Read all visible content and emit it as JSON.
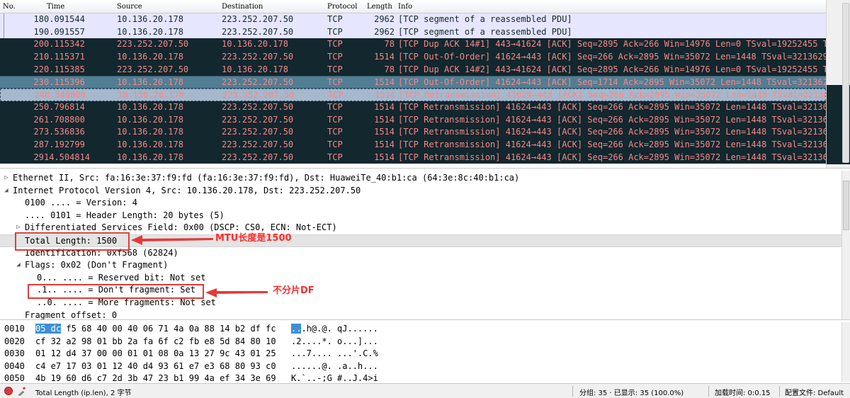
{
  "packet_list": {
    "columns": [
      "No.",
      "Time",
      "Source",
      "Destination",
      "Protocol",
      "Length",
      "Info"
    ],
    "rows": [
      {
        "no": "18",
        "time": "0.091544",
        "src": "10.136.20.178",
        "dst": "223.252.207.50",
        "proto": "TCP",
        "len": "2962",
        "info": "[TCP segment of a reassembled PDU]",
        "style": "light"
      },
      {
        "no": "19",
        "time": "0.091557",
        "src": "10.136.20.178",
        "dst": "223.252.207.50",
        "proto": "TCP",
        "len": "2962",
        "info": "[TCP segment of a reassembled PDU]",
        "style": "light"
      },
      {
        "no": "20",
        "time": "0.115342",
        "src": "223.252.207.50",
        "dst": "10.136.20.178",
        "proto": "TCP",
        "len": "78",
        "info": "[TCP Dup ACK 14#1] 443→41624 [ACK] Seq=2895 Ack=266 Win=14976 Len=0 TSval=19252455 TS",
        "style": "dark"
      },
      {
        "no": "21",
        "time": "0.115371",
        "src": "10.136.20.178",
        "dst": "223.252.207.50",
        "proto": "TCP",
        "len": "1514",
        "info": "[TCP Out-Of-Order] 41624→443 [ACK] Seq=266 Ack=2895 Win=35072 Len=1448 TSval=3213629",
        "style": "dark"
      },
      {
        "no": "22",
        "time": "0.115385",
        "src": "223.252.207.50",
        "dst": "10.136.20.178",
        "proto": "TCP",
        "len": "78",
        "info": "[TCP Dup ACK 14#2] 443→41624 [ACK] Seq=2895 Ack=266 Win=14976 Len=0 TSval=19252455 TS",
        "style": "dark"
      },
      {
        "no": "23",
        "time": "0.115396",
        "src": "10.136.20.178",
        "dst": "223.252.207.50",
        "proto": "TCP",
        "len": "1514",
        "info": "[TCP Out-Of-Order] 41624→443 [ACK] Seq=1714 Ack=2895 Win=35072 Len=1448 TSval=321362",
        "style": "dark-sel"
      },
      {
        "no": "24",
        "time": "0.340800",
        "src": "10.136.20.178",
        "dst": "223.252.207.50",
        "proto": "TCP",
        "len": "1514",
        "info": "[TCP Retransmission] 41624→443 [ACK] Seq=266 Ack=2895 Win=35072 Len=1448 TSval=32136",
        "style": "focus"
      },
      {
        "no": "25",
        "time": "0.796814",
        "src": "10.136.20.178",
        "dst": "223.252.207.50",
        "proto": "TCP",
        "len": "1514",
        "info": "[TCP Retransmission] 41624→443 [ACK] Seq=266 Ack=2895 Win=35072 Len=1448 TSval=32136",
        "style": "dark"
      },
      {
        "no": "26",
        "time": "1.708800",
        "src": "10.136.20.178",
        "dst": "223.252.207.50",
        "proto": "TCP",
        "len": "1514",
        "info": "[TCP Retransmission] 41624→443 [ACK] Seq=266 Ack=2895 Win=35072 Len=1448 TSval=32136",
        "style": "dark"
      },
      {
        "no": "27",
        "time": "3.536836",
        "src": "10.136.20.178",
        "dst": "223.252.207.50",
        "proto": "TCP",
        "len": "1514",
        "info": "[TCP Retransmission] 41624→443 [ACK] Seq=266 Ack=2895 Win=35072 Len=1448 TSval=32136",
        "style": "dark"
      },
      {
        "no": "28",
        "time": "7.192799",
        "src": "10.136.20.178",
        "dst": "223.252.207.50",
        "proto": "TCP",
        "len": "1514",
        "info": "[TCP Retransmission] 41624→443 [ACK] Seq=266 Ack=2895 Win=35072 Len=1448 TSval=32136",
        "style": "dark"
      },
      {
        "no": "29",
        "time": "14.504814",
        "src": "10.136.20.178",
        "dst": "223.252.207.50",
        "proto": "TCP",
        "len": "1514",
        "info": "[TCP Retransmission] 41624→443 [ACK] Seq=266 Ack=2895 Win=35072 Len=1448 TSval=32136",
        "style": "dark"
      }
    ]
  },
  "details": {
    "rows": [
      {
        "indent": 0,
        "toggle": "collapsed",
        "text": "Ethernet II, Src: fa:16:3e:37:f9:fd (fa:16:3e:37:f9:fd), Dst: HuaweiTe_40:b1:ca (64:3e:8c:40:b1:ca)"
      },
      {
        "indent": 0,
        "toggle": "expanded",
        "text": "Internet Protocol Version 4, Src: 10.136.20.178, Dst: 223.252.207.50"
      },
      {
        "indent": 1,
        "toggle": "none",
        "text": "0100 .... = Version: 4"
      },
      {
        "indent": 1,
        "toggle": "none",
        "text": ".... 0101 = Header Length: 20 bytes (5)"
      },
      {
        "indent": 1,
        "toggle": "collapsed",
        "text": "Differentiated Services Field: 0x00 (DSCP: CS0, ECN: Not-ECT)"
      },
      {
        "indent": 1,
        "toggle": "none",
        "text": "Total Length: 1500",
        "selected": true
      },
      {
        "indent": 1,
        "toggle": "none",
        "text": "Identification: 0xf568 (62824)"
      },
      {
        "indent": 1,
        "toggle": "expanded",
        "text": "Flags: 0x02 (Don't Fragment)"
      },
      {
        "indent": 2,
        "toggle": "none",
        "text": "0... .... = Reserved bit: Not set"
      },
      {
        "indent": 2,
        "toggle": "none",
        "text": ".1.. .... = Don't fragment: Set"
      },
      {
        "indent": 2,
        "toggle": "none",
        "text": "..0. .... = More fragments: Not set"
      },
      {
        "indent": 1,
        "toggle": "none",
        "text": "Fragment offset: 0"
      }
    ],
    "annotations": {
      "mtu": "MTU长度是1500",
      "df": "不分片DF"
    },
    "annotation_color": "#ff2b2b"
  },
  "bytes": {
    "rows": [
      {
        "offset": "0010",
        "hex_hl": "05 dc",
        "hex": "f5 68 40 00 40 06  71 4a 0a 88 14 b2 df fc",
        "ascii_hl": "..",
        "ascii": ".h@.@. qJ......"
      },
      {
        "offset": "0020",
        "hex_hl": "",
        "hex": "cf 32 a2 98 01 bb 2a fa  6f c2 fb e8 5d 84 80 10",
        "ascii_hl": "",
        "ascii": ".2....*. o...]..."
      },
      {
        "offset": "0030",
        "hex_hl": "",
        "hex": "01 12 d4 37 00 00 01 01  08 0a 13 27 9c 43 01 25",
        "ascii_hl": "",
        "ascii": "...7.... ...'.C.%"
      },
      {
        "offset": "0040",
        "hex_hl": "",
        "hex": "c4 e7 17 03 01 12 40 d4  93 61 e7 e3 68 80 93 c0",
        "ascii_hl": "",
        "ascii": "......@. .a..h..."
      },
      {
        "offset": "0050",
        "hex_hl": "",
        "hex": "4b 19 60 d6 c7 2d 3b 47  23 b1 99 4a ef 34 3e 69",
        "ascii_hl": "",
        "ascii": "K.`..-;G #..J.4>i"
      }
    ]
  },
  "statusbar": {
    "field_info": "Total Length (ip.len), 2 字节",
    "packets": "分组: 35 · 已显示: 35 (100.0%)",
    "load_time": "加载时间: 0:0.15",
    "profile": "配置文件: Default"
  },
  "colors": {
    "row_light_bg": "#e7e6ff",
    "row_dark_bg": "#12272e",
    "row_dark_fg": "#f78787",
    "row_selected_bg": "#527e93",
    "byte_highlight": "#3c8fd9"
  }
}
